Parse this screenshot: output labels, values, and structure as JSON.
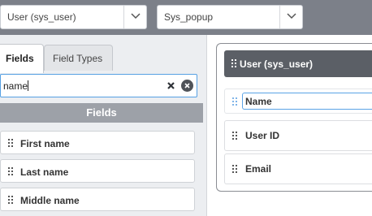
{
  "selectors": {
    "table": {
      "value": "User (sys_user)"
    },
    "view": {
      "value": "Sys_popup"
    }
  },
  "tabs": [
    {
      "label": "Fields",
      "active": true
    },
    {
      "label": "Field Types",
      "active": false
    }
  ],
  "search": {
    "value": "name"
  },
  "fields_panel": {
    "header": "Fields",
    "items": [
      {
        "label": "First name"
      },
      {
        "label": "Last name"
      },
      {
        "label": "Middle name"
      }
    ]
  },
  "form_section": {
    "title": "User (sys_user)",
    "fields": [
      {
        "label": "Name",
        "selected": true
      },
      {
        "label": "User ID"
      },
      {
        "label": "Email"
      }
    ]
  },
  "colors": {
    "topbar": "#7c8089",
    "accent": "#56a0e3",
    "section_header": "#5b5f66",
    "fields_header": "#9da1a8"
  }
}
